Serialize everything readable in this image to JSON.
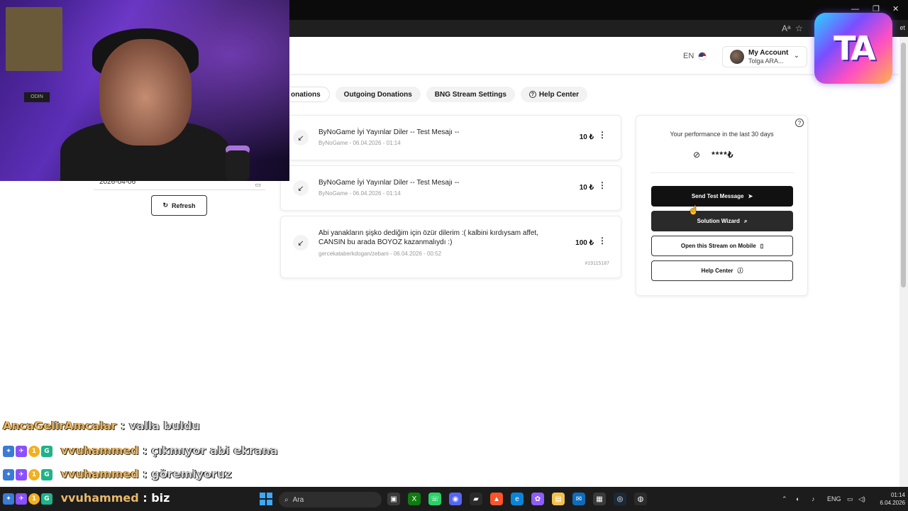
{
  "browser": {
    "window_controls": [
      "—",
      "❐",
      "✕"
    ],
    "extra_label": "et"
  },
  "header": {
    "language": "EN",
    "account": {
      "title": "My Account",
      "name": "Tolga ARA..."
    }
  },
  "logo": {
    "text": "TA"
  },
  "tabs": [
    {
      "label": "onations"
    },
    {
      "label": "Outgoing Donations"
    },
    {
      "label": "BNG Stream Settings"
    },
    {
      "label": "Help Center"
    }
  ],
  "left_panel": {
    "date_value": "2026-04-06",
    "refresh_label": "Refresh"
  },
  "donations": [
    {
      "message": "ByNoGame İyi Yayınlar Diler -- Test Mesajı --",
      "sender": "ByNoGame",
      "datetime": "06.04.2026 - 01:14",
      "amount": "10 ₺"
    },
    {
      "message": "ByNoGame İyi Yayınlar Diler -- Test Mesajı --",
      "sender": "ByNoGame",
      "datetime": "06.04.2026 - 01:14",
      "amount": "10 ₺"
    },
    {
      "message": "Abi yanakların şişko dediğim için özür dilerim :( kalbini kırdıysam affet, CANSIN bu arada BOYOZ kazanmalıydı :)",
      "sender": "gercekataberkdogan/zebani",
      "datetime": "06.04.2026 - 00:52",
      "amount": "100 ₺",
      "id": "#19115187"
    }
  ],
  "performance": {
    "title": "Your performance in the last 30 days",
    "value": "****₺",
    "buttons": {
      "send_test": "Send Test Message",
      "solution_wizard": "Solution Wizard",
      "open_mobile": "Open this Stream on Mobile",
      "help_center": "Help Center"
    }
  },
  "webcam": {
    "sign_text": "ODIN"
  },
  "chat": [
    {
      "user": "AncaGelirAmcalar",
      "message": "valla buldu",
      "badges": []
    },
    {
      "user": "vvuhammed",
      "message": "çıkmıyor abi ekrana",
      "badges": [
        "a",
        "b",
        "c",
        "d"
      ]
    },
    {
      "user": "vvuhammed",
      "message": "göremiyoruz",
      "badges": [
        "a",
        "b",
        "c",
        "d"
      ]
    },
    {
      "user": "vvuhammed",
      "message": "biz",
      "badges": [
        "a",
        "b",
        "c",
        "d"
      ]
    }
  ],
  "taskbar": {
    "search_placeholder": "Ara",
    "language": "ENG",
    "time": "01:14",
    "date": "6.04.2026"
  },
  "colors": {
    "chat_username": "#e8b86a",
    "primary_button": "#111111",
    "accent_purple": "#7b4dff"
  },
  "icons": {
    "refresh": "refresh-icon",
    "donation_arrow": "arrow-down-left-icon",
    "more": "kebab-menu-icon",
    "eye_off": "eye-off-icon",
    "send": "send-icon",
    "search": "search-icon",
    "phone": "phone-icon",
    "help": "help-circle-icon"
  }
}
